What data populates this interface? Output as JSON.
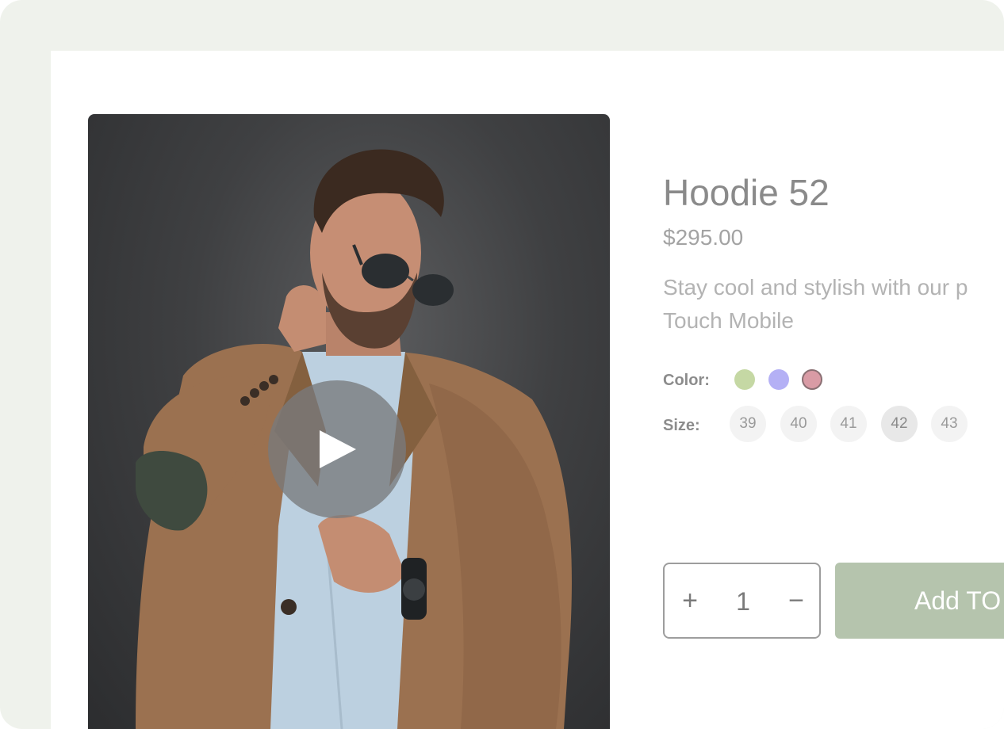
{
  "product": {
    "title": "Hoodie 52",
    "price": "$295.00",
    "description_lines": [
      "Stay cool and stylish with our p",
      "Touch Mobile"
    ]
  },
  "options": {
    "color_label": "Color:",
    "colors": [
      "#c5d8a4",
      "#b4b0f5",
      "#d99ba5"
    ],
    "size_label": "Size:",
    "sizes": [
      "39",
      "40",
      "41",
      "42",
      "43"
    ],
    "selected_size": "42"
  },
  "cart": {
    "plus_label": "+",
    "quantity": "1",
    "minus_label": "−",
    "add_label": "Add TO"
  },
  "media": {
    "play_icon": "play-icon",
    "image_subject": "man in brown blazer and sunglasses"
  },
  "colors": {
    "frame_bg": "#eff2ec",
    "accent": "#b5c4ad"
  }
}
